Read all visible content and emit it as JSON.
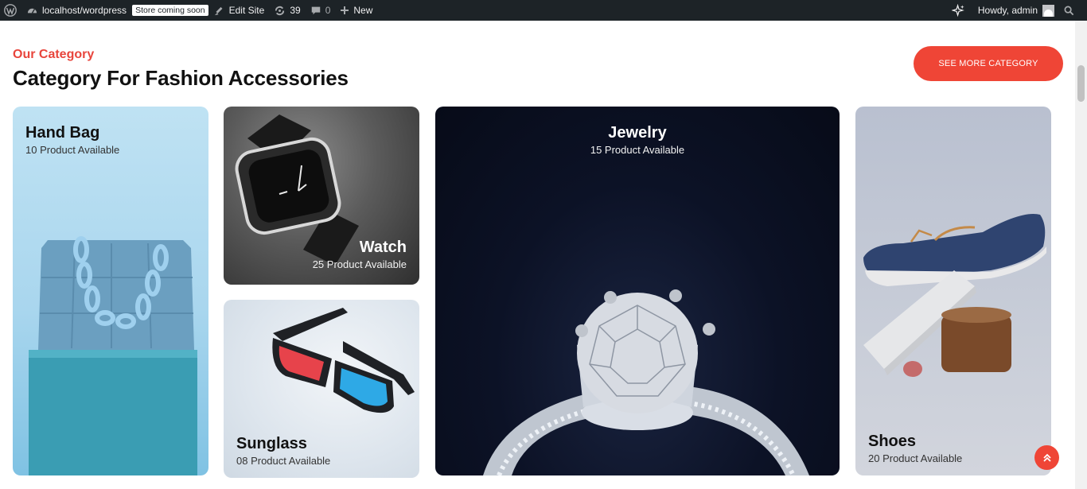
{
  "adminbar": {
    "site_url": "localhost/wordpress",
    "store_badge": "Store coming soon",
    "edit_site": "Edit Site",
    "updates_count": "39",
    "comments_count": "0",
    "new_label": "New",
    "howdy": "Howdy, admin",
    "icons": [
      "wordpress-logo-icon",
      "dashboard-icon",
      "brush-icon",
      "updates-icon",
      "comment-icon",
      "plus-icon",
      "ai-sparkle-icon",
      "search-icon"
    ]
  },
  "section": {
    "eyebrow": "Our Category",
    "title": "Category For Fashion Accessories",
    "see_more": "SEE MORE CATEGORY"
  },
  "categories": [
    {
      "name": "Hand Bag",
      "count": "10 Product Available"
    },
    {
      "name": "Watch",
      "count": "25 Product Available"
    },
    {
      "name": "Sunglass",
      "count": "08 Product Available"
    },
    {
      "name": "Jewelry",
      "count": "15 Product Available"
    },
    {
      "name": "Shoes",
      "count": "20 Product Available"
    }
  ],
  "colors": {
    "accent": "#ef4536",
    "adminbar": "#1d2327",
    "heading": "#111111"
  }
}
